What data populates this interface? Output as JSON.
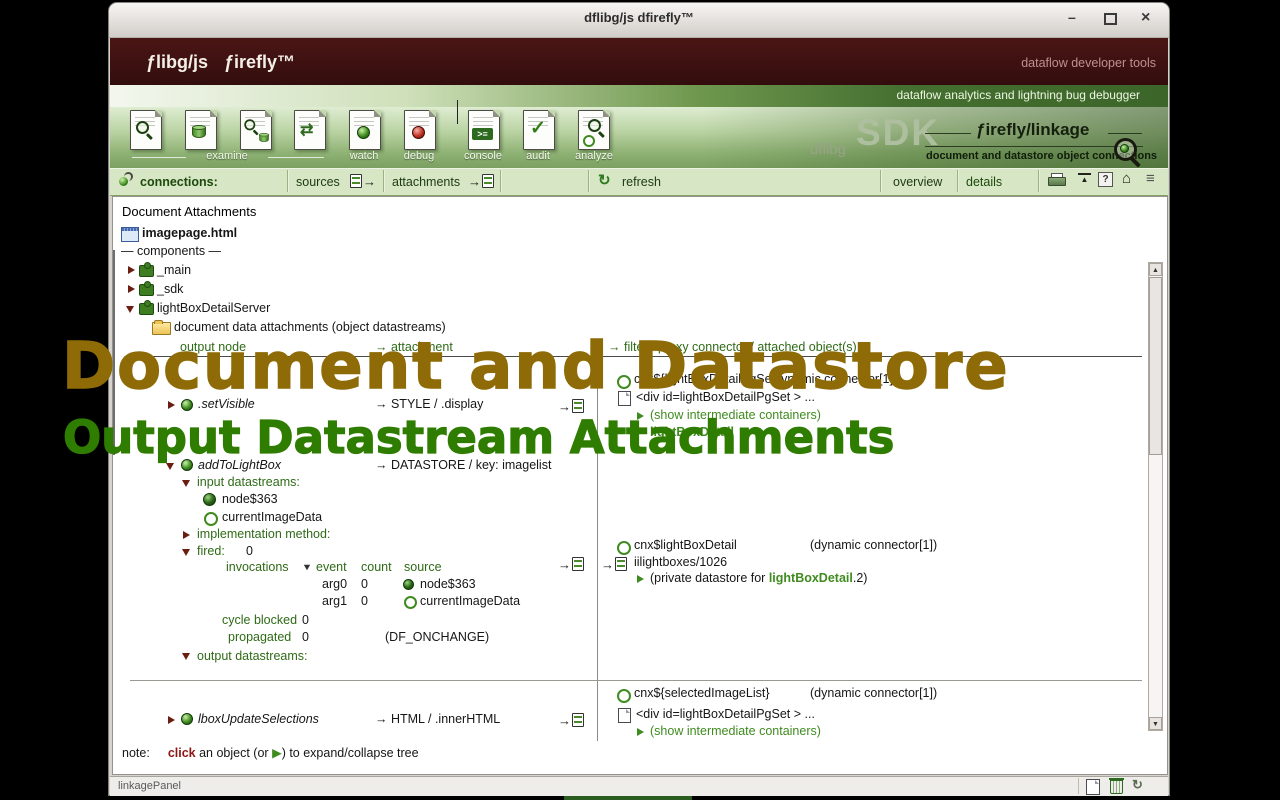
{
  "window": {
    "title": "dflibg/js dfirefly™"
  },
  "icons": {
    "minimize_glyph": "–",
    "close_glyph": "×",
    "arrow_glyph": "→",
    "sync_glyph": "⇄",
    "check_glyph": "✓",
    "console_glyph": ">≡",
    "refresh_glyph": "↻",
    "collapse_glyph": "▲",
    "help_glyph": "?",
    "home_glyph": "⌂",
    "menu_glyph": "≡",
    "scroll_up_glyph": "▲",
    "scroll_down_glyph": "▼"
  },
  "brand": {
    "logo_left": "ƒlibg/js",
    "logo_right": "ƒirefly™",
    "tagline": "dataflow developer tools"
  },
  "subtitle_bar": {
    "text": "dataflow analytics and lightning bug debugger"
  },
  "toolbar": {
    "examine_label": "examine",
    "watch_label": "watch",
    "debug_label": "debug",
    "console_label": "console",
    "audit_label": "audit",
    "analyze_label": "analyze",
    "sdk_watermark": "SDK",
    "sdk_small": "dflibg",
    "product": "ƒirefly/linkage",
    "product_caption": "document and datastore object connections"
  },
  "menubar": {
    "connections": "connections:",
    "sources": "sources",
    "attachments": "attachments",
    "refresh": "refresh",
    "overview": "overview",
    "details": "details"
  },
  "content": {
    "heading": "Document Attachments",
    "file_name": "imagepage.html",
    "components": "— components —",
    "node_main": "_main",
    "node_sdk": "_sdk",
    "node_server": "lightBoxDetailServer",
    "attachments_title": "document data attachments (object datastreams)",
    "col_output": "output node",
    "col_attachment": "→ attachment",
    "col_filter": "→ filter / proxy connector / attached object(s)",
    "sec1": {
      "connector": "cnx${lightBoxDetailPgSet}",
      "connector_type": "(dynamic connector[1])",
      "div": "<div id=lightBoxDetailPgSet > ...",
      "show": "(show intermediate containers)",
      "hidden_fragment": "lightBoxDetail"
    },
    "row_setVisible": {
      "name": ".setVisible",
      "attachment": "→ STYLE / .display"
    },
    "row_addToLightBox": {
      "name": "addToLightBox",
      "attachment": "→ DATASTORE / key: imagelist"
    },
    "input_ds_label": "input datastreams:",
    "ds_node363": "node$363",
    "ds_currentImageData": "currentImageData",
    "impl_label": "implementation method:",
    "fired_label": "fired:",
    "fired_count": "0",
    "invocations_label": "invocations",
    "event_label": "event",
    "count_label": "count",
    "source_label": "source",
    "arg0_label": "arg0",
    "arg0_count": "0",
    "arg1_label": "arg1",
    "arg1_count": "0",
    "cycle_label": "cycle blocked",
    "cycle_count": "0",
    "prop_label": "propagated",
    "prop_count": "0",
    "prop_event": "(DF_ONCHANGE)",
    "output_ds_label": "output datastreams:",
    "sec2": {
      "connector": "cnx$lightBoxDetail",
      "connector_type": "(dynamic connector[1])",
      "datastore": "iilightboxes/1026",
      "private_prefix": "(private datastore for ",
      "private_name": "lightBoxDetail",
      "private_suffix": ".2)"
    },
    "row_lboxUpdate": {
      "name": "lboxUpdateSelections",
      "attachment": "→ HTML / .innerHTML"
    },
    "sec3": {
      "connector": "cnx${selectedImageList}",
      "connector_type": "(dynamic connector[1])",
      "div": "<div id=lightBoxDetailPgSet > ...",
      "show": "(show intermediate containers)"
    },
    "note_label": "note:",
    "note_click": "click",
    "note_mid": " an object (or ",
    "note_tri": "▶",
    "note_end": ") to expand/collapse tree"
  },
  "overlay": {
    "title1": "Document and Datastore",
    "title2": "Output Datastream Attachments",
    "title1_color": "#8e6b06",
    "title2_color": "#2f7d00"
  },
  "statusbar": {
    "panel": "linkagePanel"
  }
}
